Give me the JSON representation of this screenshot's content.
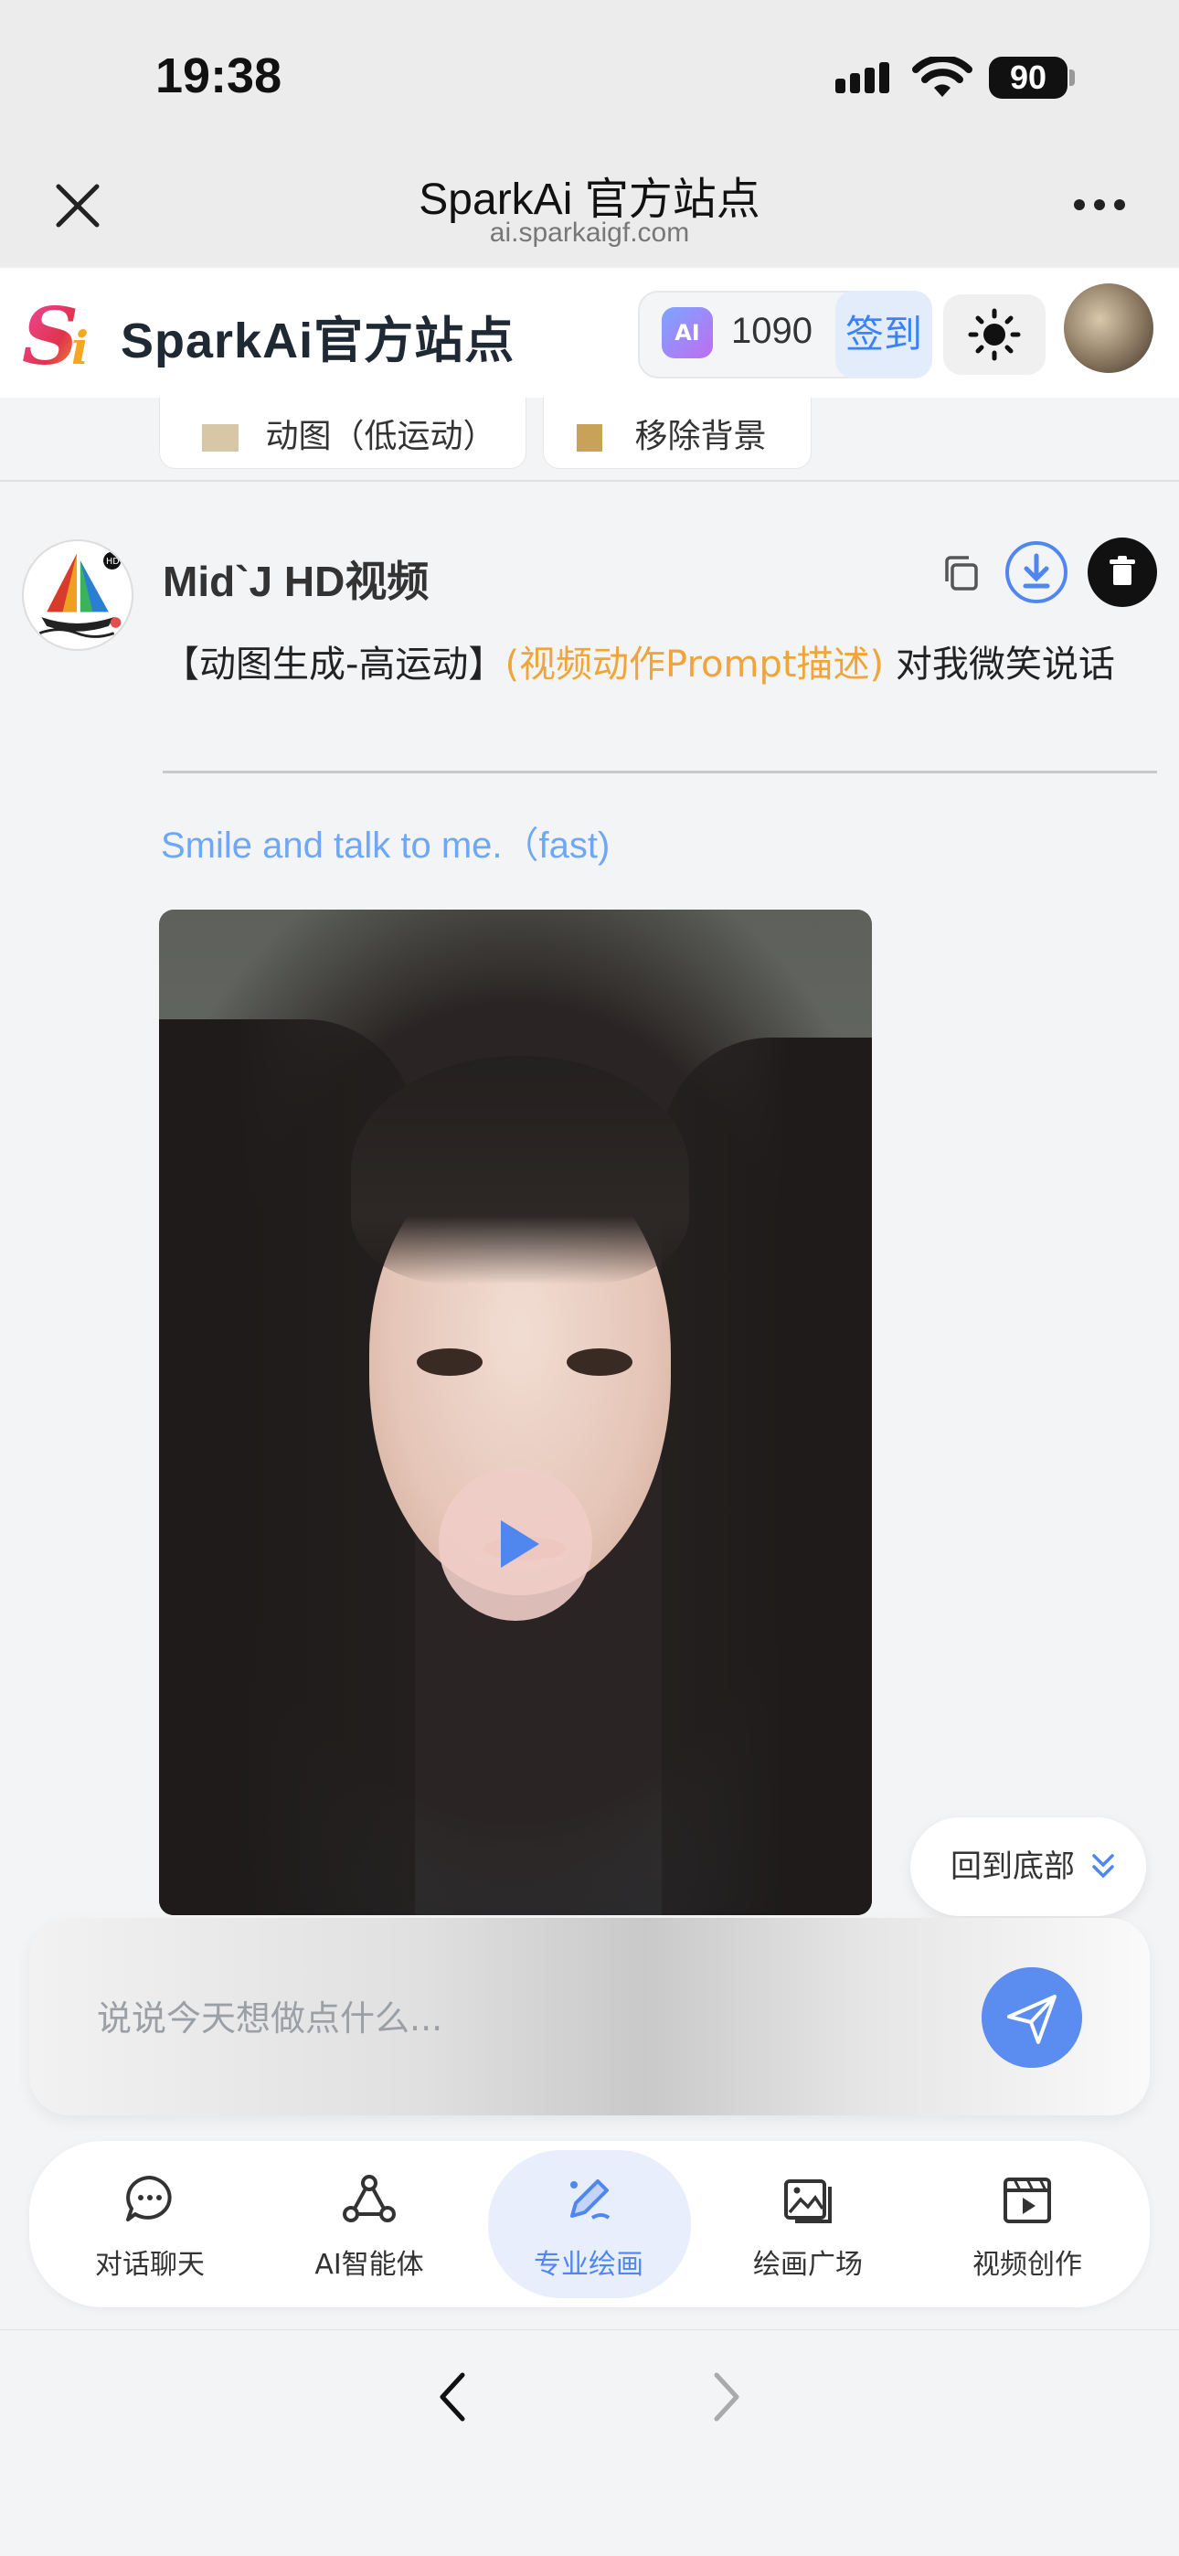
{
  "status_bar": {
    "time": "19:38",
    "battery": "90"
  },
  "browser": {
    "title": "SparkAi 官方站点",
    "url": "ai.sparkaigf.com"
  },
  "app": {
    "name": "SparkAi官方站点",
    "points": "1090",
    "ai_badge": "AI",
    "signin_label": "签到"
  },
  "chips": [
    "动图（低运动）",
    "移除背景"
  ],
  "message": {
    "bot_name": "Mid`J HD视频",
    "prompt_prefix": "【动图生成-高运动】",
    "prompt_highlight": "(视频动作Prompt描述)",
    "prompt_text": "对我微笑说话",
    "translated": "Smile and talk to me.（fast)"
  },
  "back_to_bottom": "回到底部",
  "input": {
    "placeholder": "说说今天想做点什么..."
  },
  "nav": {
    "items": [
      {
        "label": "对话聊天",
        "icon": "chat-icon"
      },
      {
        "label": "AI智能体",
        "icon": "agent-icon"
      },
      {
        "label": "专业绘画",
        "icon": "draw-icon",
        "active": true
      },
      {
        "label": "绘画广场",
        "icon": "gallery-icon"
      },
      {
        "label": "视频创作",
        "icon": "video-icon"
      }
    ]
  },
  "colors": {
    "accent": "#4f86f0",
    "highlight": "#f0a53a",
    "translated": "#6ea8f5"
  }
}
